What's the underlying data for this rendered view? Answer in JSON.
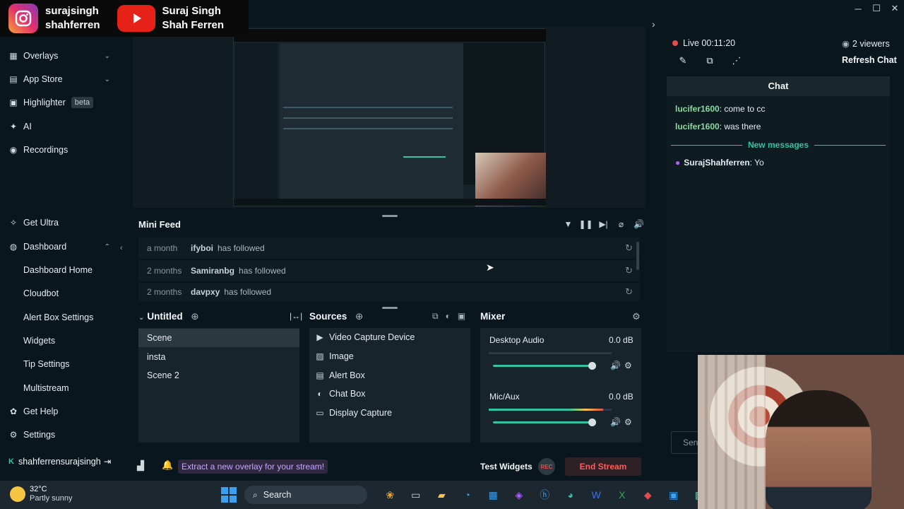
{
  "social": {
    "instagram": {
      "line1": "surajsingh",
      "line2": "shahferren"
    },
    "youtube": {
      "line1": "Suraj Singh",
      "line2": "Shah Ferren"
    }
  },
  "sidebar": {
    "items": [
      {
        "label": "Overlays",
        "icon": "overlays-icon"
      },
      {
        "label": "App Store",
        "icon": "store-icon"
      },
      {
        "label": "Highlighter",
        "icon": "highlighter-icon",
        "badge": "beta"
      },
      {
        "label": "AI",
        "icon": "ai-icon"
      },
      {
        "label": "Recordings",
        "icon": "recordings-icon"
      },
      {
        "label": "Get Ultra",
        "icon": "ultra-icon"
      },
      {
        "label": "Dashboard",
        "icon": "dashboard-icon"
      }
    ],
    "dashboard_sub": [
      "Dashboard Home",
      "Cloudbot",
      "Alert Box Settings",
      "Widgets",
      "Tip Settings",
      "Multistream"
    ],
    "bottom": [
      {
        "label": "Get Help",
        "icon": "help-icon"
      },
      {
        "label": "Settings",
        "icon": "gear-icon"
      }
    ],
    "user": "shahferrensurajsingh"
  },
  "mini_feed": {
    "title": "Mini Feed",
    "rows": [
      {
        "age": "a month",
        "user": "ifyboi",
        "action": "has followed"
      },
      {
        "age": "2 months",
        "user": "Samiranbg",
        "action": "has followed"
      },
      {
        "age": "2 months",
        "user": "davpxy",
        "action": "has followed"
      }
    ]
  },
  "scenes": {
    "title": "Untitled",
    "items": [
      "Scene",
      "insta",
      "Scene 2"
    ]
  },
  "sources": {
    "title": "Sources",
    "items": [
      {
        "label": "Video Capture Device",
        "icon": "camera-icon"
      },
      {
        "label": "Image",
        "icon": "image-icon"
      },
      {
        "label": "Alert Box",
        "icon": "alert-icon"
      },
      {
        "label": "Chat Box",
        "icon": "chat-icon"
      },
      {
        "label": "Display Capture",
        "icon": "monitor-icon"
      }
    ]
  },
  "mixer": {
    "title": "Mixer",
    "channels": [
      {
        "name": "Desktop Audio",
        "db": "0.0 dB",
        "level": 0.0,
        "volume": 0.96
      },
      {
        "name": "Mic/Aux",
        "db": "0.0 dB",
        "level": 0.93,
        "volume": 0.96
      }
    ]
  },
  "bottom": {
    "promo": "Extract a new overlay for your stream!",
    "test_widgets": "Test Widgets",
    "rec": "REC",
    "end_stream": "End Stream"
  },
  "chat": {
    "live": "Live 00:11:20",
    "viewers": "2 viewers",
    "refresh": "Refresh Chat",
    "header": "Chat",
    "messages": [
      {
        "user": "lucifer1600",
        "text": ": come to cc"
      },
      {
        "user": "lucifer1600",
        "text": ": was there"
      }
    ],
    "new_messages": "New messages",
    "own": {
      "user": "SurajShahferren",
      "text": ": Yo"
    },
    "send": "Sen"
  },
  "taskbar": {
    "temp": "32°C",
    "weather": "Partly sunny",
    "search": "Search"
  },
  "colors": {
    "accent": "#31c3a2",
    "danger": "#e34c4c",
    "bg": "#09161d",
    "panel": "#17242b"
  }
}
